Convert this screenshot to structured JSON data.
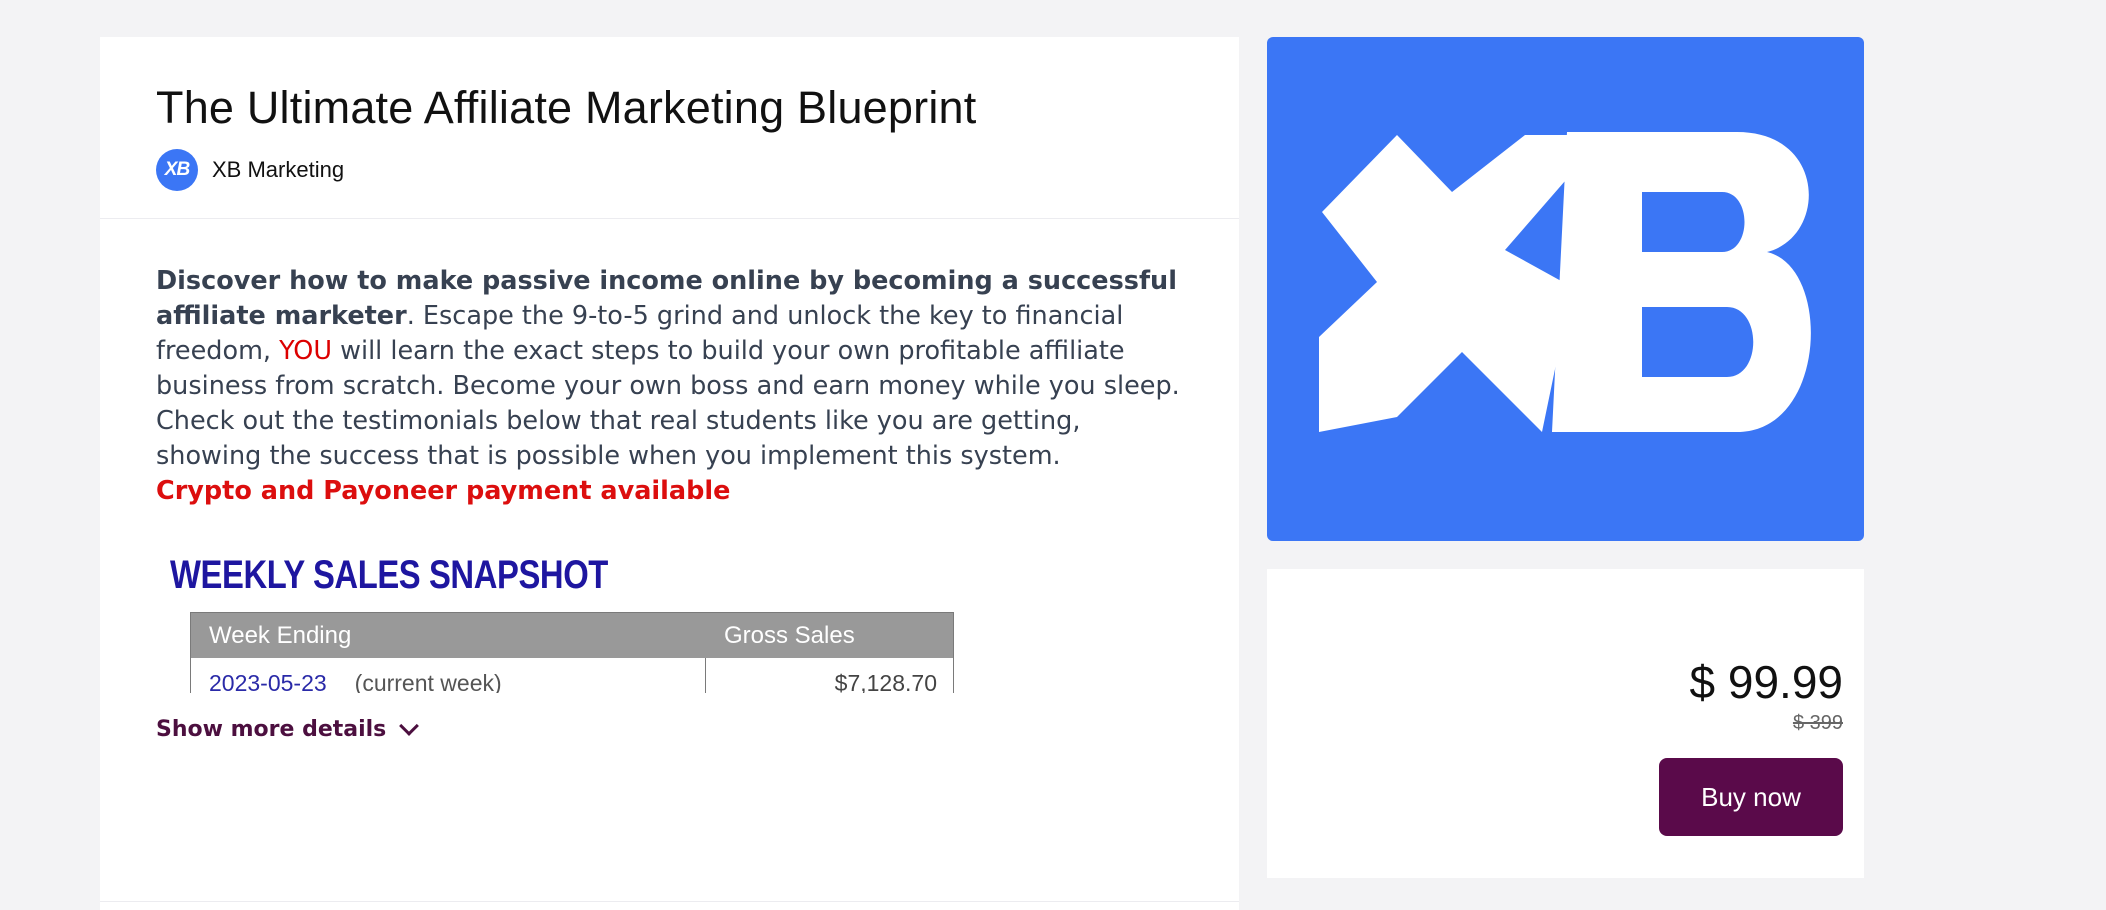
{
  "product": {
    "title": "The Ultimate Affiliate Marketing Blueprint",
    "seller_initials": "XB",
    "seller_name": "XB Marketing"
  },
  "description": {
    "bold_intro": "Discover how to make passive income online by becoming a successful affiliate marketer",
    "text_before_you": ". Escape the 9-to-5 grind and unlock the key to financial freedom, ",
    "you": "YOU",
    "text_after_you": " will learn the exact steps to build your own profitable affiliate business from scratch. Become your own boss and earn money while you sleep. Check out the testimonials below that real students like you are getting, showing the success that is possible when you implement this system.",
    "payment_note": "Crypto and Payoneer payment available"
  },
  "snapshot": {
    "title": "WEEKLY SALES SNAPSHOT",
    "col_week": "Week Ending",
    "col_sales": "Gross Sales",
    "row_date": "2023-05-23",
    "row_note": "(current week)",
    "row_sales": "$7,128.70"
  },
  "show_more_label": "Show more details",
  "pricing": {
    "price": "$ 99.99",
    "original_price": "$ 399",
    "buy_label": "Buy now"
  },
  "colors": {
    "brand_blue": "#3b76f5",
    "button_purple": "#5a0a4a",
    "alert_red": "#dc0e0e"
  }
}
